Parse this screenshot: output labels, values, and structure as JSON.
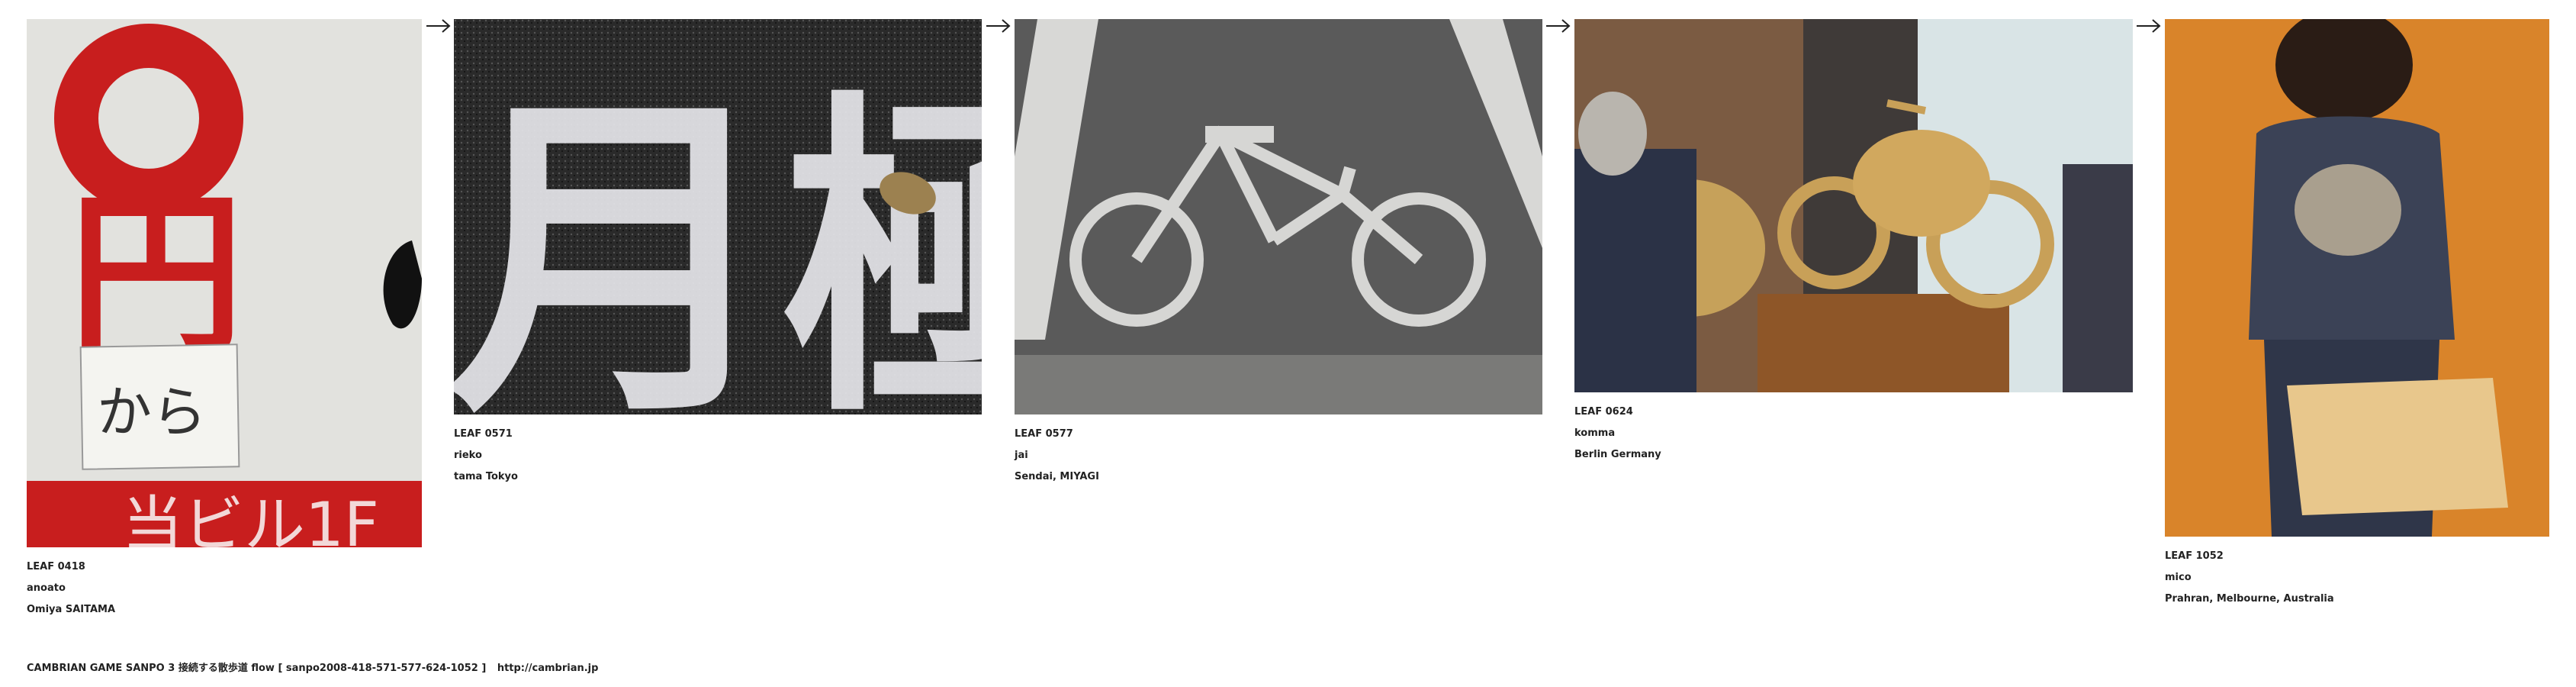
{
  "leaves": [
    {
      "number": "LEAF 0418",
      "author": "anoato",
      "location": "Omiya SAITAMA",
      "sign_text": "円",
      "note_text": "から",
      "bottom_text": "当ビル1F"
    },
    {
      "number": "LEAF 0571",
      "author": "rieko",
      "location": "tama Tokyo",
      "road_text": "月極"
    },
    {
      "number": "LEAF 0577",
      "author": "jai",
      "location": "Sendai, MIYAGI"
    },
    {
      "number": "LEAF 0624",
      "author": "komma",
      "location": "Berlin Germany"
    },
    {
      "number": "LEAF 1052",
      "author": "mico",
      "location": "Prahran, Melbourne, Australia"
    }
  ],
  "arrow_glyph": "→",
  "footer": {
    "text": "CAMBRIAN GAME SANPO 3 接続する散歩道 flow [ sanpo2008-418-571-577-624-1052 ]",
    "link": "http://cambrian.jp"
  }
}
